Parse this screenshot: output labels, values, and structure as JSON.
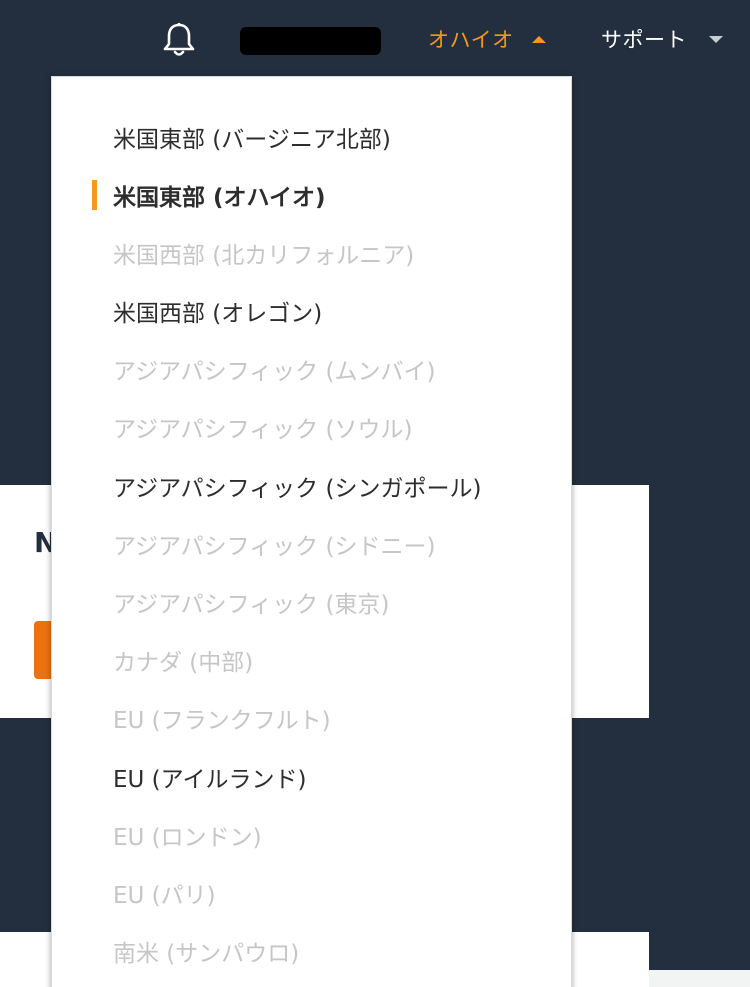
{
  "nav": {
    "region_label": "オハイオ",
    "support_label": "サポート",
    "bell_icon": "bell-icon"
  },
  "background": {
    "card_heading": "N"
  },
  "regions": [
    {
      "label": "米国東部 (バージニア北部)",
      "state": "enabled"
    },
    {
      "label": "米国東部 (オハイオ)",
      "state": "selected"
    },
    {
      "label": "米国西部 (北カリフォルニア)",
      "state": "disabled"
    },
    {
      "label": "米国西部 (オレゴン)",
      "state": "enabled"
    },
    {
      "label": "アジアパシフィック (ムンバイ)",
      "state": "disabled"
    },
    {
      "label": "アジアパシフィック (ソウル)",
      "state": "disabled"
    },
    {
      "label": "アジアパシフィック (シンガポール)",
      "state": "enabled"
    },
    {
      "label": "アジアパシフィック (シドニー)",
      "state": "disabled"
    },
    {
      "label": "アジアパシフィック (東京)",
      "state": "disabled"
    },
    {
      "label": "カナダ (中部)",
      "state": "disabled"
    },
    {
      "label": "EU (フランクフルト)",
      "state": "disabled"
    },
    {
      "label": "EU (アイルランド)",
      "state": "enabled"
    },
    {
      "label": "EU (ロンドン)",
      "state": "disabled"
    },
    {
      "label": "EU (パリ)",
      "state": "disabled"
    },
    {
      "label": "南米 (サンパウロ)",
      "state": "disabled"
    }
  ],
  "colors": {
    "nav_background": "#232f3e",
    "accent": "#f7981d",
    "disabled_text": "#c6c6c6",
    "enabled_text": "#2d2d2d"
  }
}
